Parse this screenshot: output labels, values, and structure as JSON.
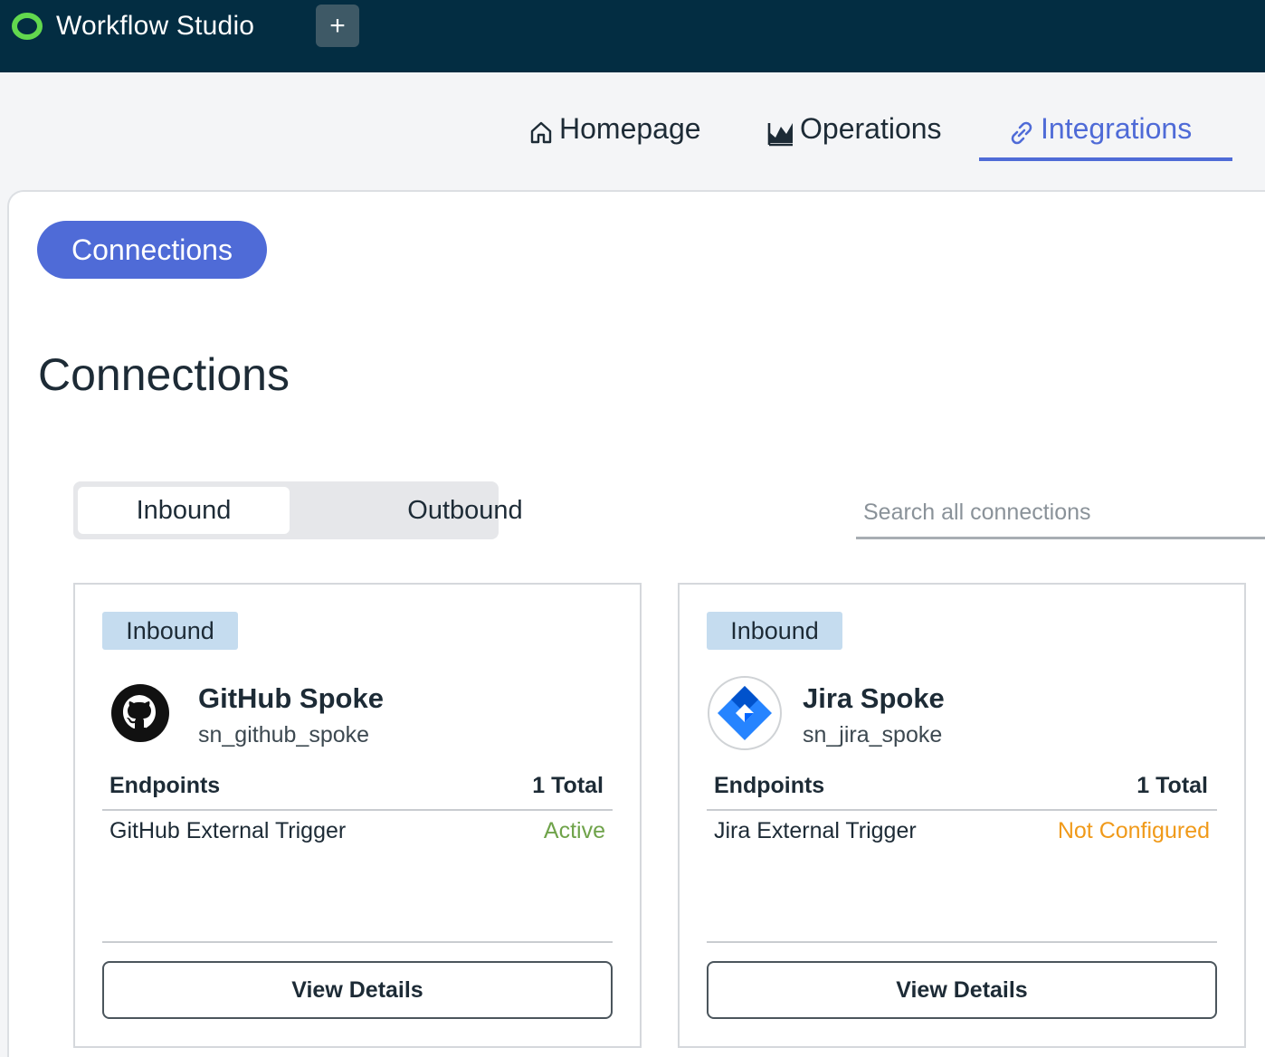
{
  "header": {
    "app_title": "Workflow Studio",
    "add_button_label": "+"
  },
  "nav": {
    "items": [
      {
        "label": "Homepage",
        "icon": "home-icon"
      },
      {
        "label": "Operations",
        "icon": "chart-icon"
      },
      {
        "label": "Integrations",
        "icon": "link-icon",
        "active": true
      }
    ]
  },
  "subnav": {
    "pill_label": "Connections"
  },
  "page": {
    "title": "Connections"
  },
  "toggle": {
    "options": [
      "Inbound",
      "Outbound"
    ],
    "selected": "Inbound"
  },
  "search": {
    "placeholder": "Search all connections",
    "value": ""
  },
  "cards": [
    {
      "badge": "Inbound",
      "name": "GitHub Spoke",
      "id": "sn_github_spoke",
      "logo": "github-icon",
      "endpoints_label": "Endpoints",
      "endpoints_total": "1 Total",
      "endpoint": {
        "name": "GitHub External Trigger",
        "status": "Active"
      },
      "button_label": "View Details"
    },
    {
      "badge": "Inbound",
      "name": "Jira Spoke",
      "id": "sn_jira_spoke",
      "logo": "jira-icon",
      "endpoints_label": "Endpoints",
      "endpoints_total": "1 Total",
      "endpoint": {
        "name": "Jira External Trigger",
        "status": "Not Configured"
      },
      "button_label": "View Details"
    }
  ],
  "colors": {
    "topbar": "#032d42",
    "accent": "#4f6bd7",
    "badge": "#c5dcef",
    "status_active": "#6fa34a",
    "status_not_configured": "#f09a1a"
  }
}
